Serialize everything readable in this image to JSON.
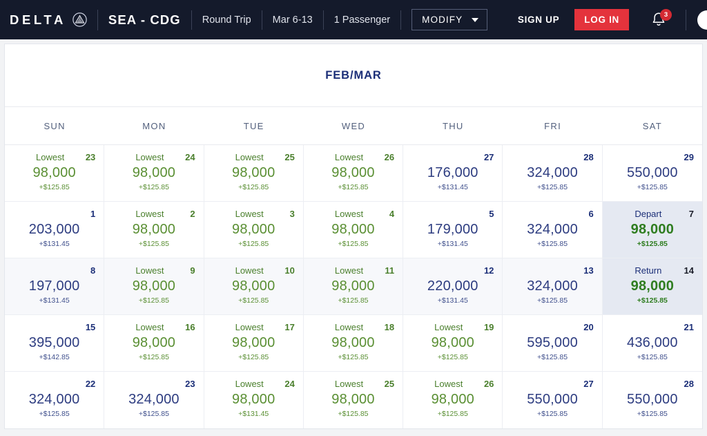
{
  "header": {
    "brand": "DELTA",
    "brand_icon": "delta-widget-icon",
    "route": "SEA - CDG",
    "trip_type": "Round Trip",
    "dates": "Mar 6-13",
    "passengers": "1 Passenger",
    "modify_label": "MODIFY",
    "sign_up": "SIGN UP",
    "log_in": "LOG IN",
    "notification_count": "3",
    "colors": {
      "bar": "#141a2b",
      "login_red": "#e4333c",
      "badge_red": "#d42a33"
    }
  },
  "calendar": {
    "month_title": "FEB/MAR",
    "day_headers": [
      "SUN",
      "MON",
      "TUE",
      "WED",
      "THU",
      "FRI",
      "SAT"
    ],
    "labels": {
      "lowest": "Lowest",
      "depart": "Depart",
      "return": "Return"
    },
    "colors": {
      "navy": "#2d3c80",
      "green": "#5a8f33",
      "endpoint_bg": "#e5e9f2",
      "week_bg": "#f7f8fb",
      "title_navy": "#1c2f78"
    },
    "weeks": [
      [
        {
          "day": "23",
          "miles": "98,000",
          "fee": "+$125.85",
          "tag": "Lowest",
          "state": "lowest"
        },
        {
          "day": "24",
          "miles": "98,000",
          "fee": "+$125.85",
          "tag": "Lowest",
          "state": "lowest"
        },
        {
          "day": "25",
          "miles": "98,000",
          "fee": "+$125.85",
          "tag": "Lowest",
          "state": "lowest"
        },
        {
          "day": "26",
          "miles": "98,000",
          "fee": "+$125.85",
          "tag": "Lowest",
          "state": "lowest"
        },
        {
          "day": "27",
          "miles": "176,000",
          "fee": "+$131.45",
          "tag": "",
          "state": "normal"
        },
        {
          "day": "28",
          "miles": "324,000",
          "fee": "+$125.85",
          "tag": "",
          "state": "normal"
        },
        {
          "day": "29",
          "miles": "550,000",
          "fee": "+$125.85",
          "tag": "",
          "state": "normal"
        }
      ],
      [
        {
          "day": "1",
          "miles": "203,000",
          "fee": "+$131.45",
          "tag": "",
          "state": "normal"
        },
        {
          "day": "2",
          "miles": "98,000",
          "fee": "+$125.85",
          "tag": "Lowest",
          "state": "lowest"
        },
        {
          "day": "3",
          "miles": "98,000",
          "fee": "+$125.85",
          "tag": "Lowest",
          "state": "lowest"
        },
        {
          "day": "4",
          "miles": "98,000",
          "fee": "+$125.85",
          "tag": "Lowest",
          "state": "lowest"
        },
        {
          "day": "5",
          "miles": "179,000",
          "fee": "+$131.45",
          "tag": "",
          "state": "normal"
        },
        {
          "day": "6",
          "miles": "324,000",
          "fee": "+$125.85",
          "tag": "",
          "state": "normal"
        },
        {
          "day": "7",
          "miles": "98,000",
          "fee": "+$125.85",
          "tag": "Depart",
          "state": "endpoint"
        }
      ],
      [
        {
          "day": "8",
          "miles": "197,000",
          "fee": "+$131.45",
          "tag": "",
          "state": "week"
        },
        {
          "day": "9",
          "miles": "98,000",
          "fee": "+$125.85",
          "tag": "Lowest",
          "state": "week-lowest"
        },
        {
          "day": "10",
          "miles": "98,000",
          "fee": "+$125.85",
          "tag": "Lowest",
          "state": "week-lowest"
        },
        {
          "day": "11",
          "miles": "98,000",
          "fee": "+$125.85",
          "tag": "Lowest",
          "state": "week-lowest"
        },
        {
          "day": "12",
          "miles": "220,000",
          "fee": "+$131.45",
          "tag": "",
          "state": "week"
        },
        {
          "day": "13",
          "miles": "324,000",
          "fee": "+$125.85",
          "tag": "",
          "state": "week"
        },
        {
          "day": "14",
          "miles": "98,000",
          "fee": "+$125.85",
          "tag": "Return",
          "state": "endpoint"
        }
      ],
      [
        {
          "day": "15",
          "miles": "395,000",
          "fee": "+$142.85",
          "tag": "",
          "state": "normal"
        },
        {
          "day": "16",
          "miles": "98,000",
          "fee": "+$125.85",
          "tag": "Lowest",
          "state": "lowest"
        },
        {
          "day": "17",
          "miles": "98,000",
          "fee": "+$125.85",
          "tag": "Lowest",
          "state": "lowest"
        },
        {
          "day": "18",
          "miles": "98,000",
          "fee": "+$125.85",
          "tag": "Lowest",
          "state": "lowest"
        },
        {
          "day": "19",
          "miles": "98,000",
          "fee": "+$125.85",
          "tag": "Lowest",
          "state": "lowest"
        },
        {
          "day": "20",
          "miles": "595,000",
          "fee": "+$125.85",
          "tag": "",
          "state": "normal"
        },
        {
          "day": "21",
          "miles": "436,000",
          "fee": "+$125.85",
          "tag": "",
          "state": "normal"
        }
      ],
      [
        {
          "day": "22",
          "miles": "324,000",
          "fee": "+$125.85",
          "tag": "",
          "state": "normal"
        },
        {
          "day": "23",
          "miles": "324,000",
          "fee": "+$125.85",
          "tag": "",
          "state": "normal"
        },
        {
          "day": "24",
          "miles": "98,000",
          "fee": "+$131.45",
          "tag": "Lowest",
          "state": "lowest"
        },
        {
          "day": "25",
          "miles": "98,000",
          "fee": "+$125.85",
          "tag": "Lowest",
          "state": "lowest"
        },
        {
          "day": "26",
          "miles": "98,000",
          "fee": "+$125.85",
          "tag": "Lowest",
          "state": "lowest"
        },
        {
          "day": "27",
          "miles": "550,000",
          "fee": "+$125.85",
          "tag": "",
          "state": "normal"
        },
        {
          "day": "28",
          "miles": "550,000",
          "fee": "+$125.85",
          "tag": "",
          "state": "normal"
        }
      ]
    ]
  }
}
